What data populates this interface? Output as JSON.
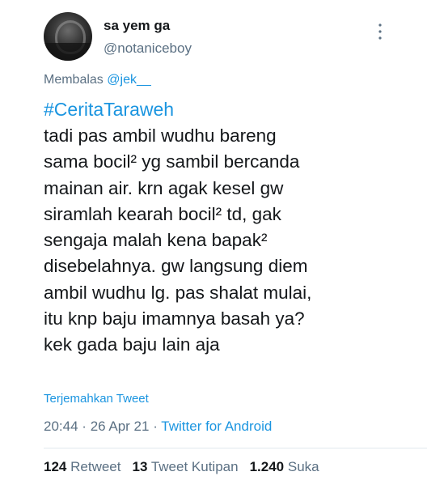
{
  "author": {
    "display_name": "sa yem ga",
    "username": "@notaniceboy",
    "avatar_icon": "profile-photo"
  },
  "reply": {
    "prefix": "Membalas",
    "handle": "@jek__"
  },
  "tweet": {
    "hashtag": "#CeritaTaraweh",
    "lines": [
      "tadi pas ambil wudhu bareng",
      "sama bocil² yg sambil bercanda",
      "mainan air. krn agak kesel gw",
      "siramlah kearah bocil² td, gak",
      "sengaja malah kena bapak²",
      "disebelahnya. gw langsung diem",
      "ambil wudhu lg. pas shalat mulai,",
      "itu knp baju imamnya basah ya?",
      "kek gada baju lain aja"
    ],
    "translate_label": "Terjemahkan Tweet"
  },
  "meta": {
    "time": "20:44",
    "separator": "·",
    "date": "26 Apr 21",
    "source": "Twitter for Android"
  },
  "stats": {
    "retweets_count": "124",
    "retweets_label": "Retweet",
    "quotes_count": "13",
    "quotes_label": "Tweet Kutipan",
    "likes_count": "1.240",
    "likes_label": "Suka"
  },
  "colors": {
    "link": "#1b95e0",
    "secondary_text": "#5b7083",
    "primary_text": "#14171a",
    "divider": "#e1e8ed"
  }
}
